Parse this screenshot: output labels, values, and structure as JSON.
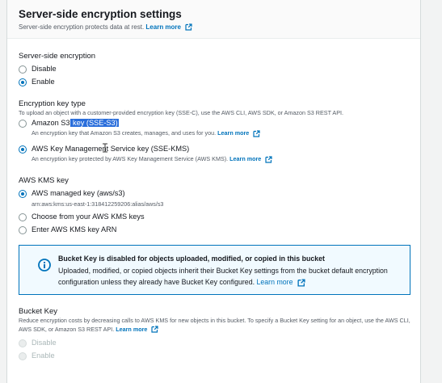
{
  "header": {
    "title": "Server-side encryption settings",
    "description": "Server-side encryption protects data at rest.",
    "learn_more": "Learn more"
  },
  "sse": {
    "label": "Server-side encryption",
    "options": [
      {
        "label": "Disable",
        "selected": false
      },
      {
        "label": "Enable",
        "selected": true
      }
    ]
  },
  "key_type": {
    "label": "Encryption key type",
    "description": "To upload an object with a customer-provided encryption key (SSE-C), use the AWS CLI, AWS SDK, or Amazon S3 REST API.",
    "options": [
      {
        "label_prefix": "Amazon S3",
        "label_highlight": " key (SSE-S3)",
        "description": "An encryption key that Amazon S3 creates, manages, and uses for you.",
        "learn_more": "Learn more",
        "selected": false
      },
      {
        "label": "AWS Key Management Service key (SSE-KMS)",
        "description": "An encryption key protected by AWS Key Management Service (AWS KMS).",
        "learn_more": "Learn more",
        "selected": true
      }
    ]
  },
  "kms_key": {
    "label": "AWS KMS key",
    "options": [
      {
        "label": "AWS managed key (aws/s3)",
        "selected": true
      },
      {
        "label": "Choose from your AWS KMS keys",
        "selected": false
      },
      {
        "label": "Enter AWS KMS key ARN",
        "selected": false
      }
    ],
    "arn": "arn:aws:kms:us-east-1:318412259206:alias/aws/s3"
  },
  "info": {
    "title": "Bucket Key is disabled for objects uploaded, modified, or copied in this bucket",
    "body": "Uploaded, modified, or copied objects inherit their Bucket Key settings from the bucket default encryption configuration unless they already have Bucket Key configured.",
    "learn_more": "Learn more"
  },
  "bucket_key": {
    "label": "Bucket Key",
    "description": "Reduce encryption costs by decreasing calls to AWS KMS for new objects in this bucket. To specify a Bucket Key setting for an object, use the AWS CLI, AWS SDK, or Amazon S3 REST API.",
    "learn_more": "Learn more",
    "options": [
      {
        "label": "Disable",
        "disabled": true
      },
      {
        "label": "Enable",
        "disabled": true
      }
    ]
  },
  "colors": {
    "link": "#0073bb",
    "selection_highlight": "#2a6edb",
    "info_border": "#0073bb",
    "info_background": "#f1faff"
  }
}
